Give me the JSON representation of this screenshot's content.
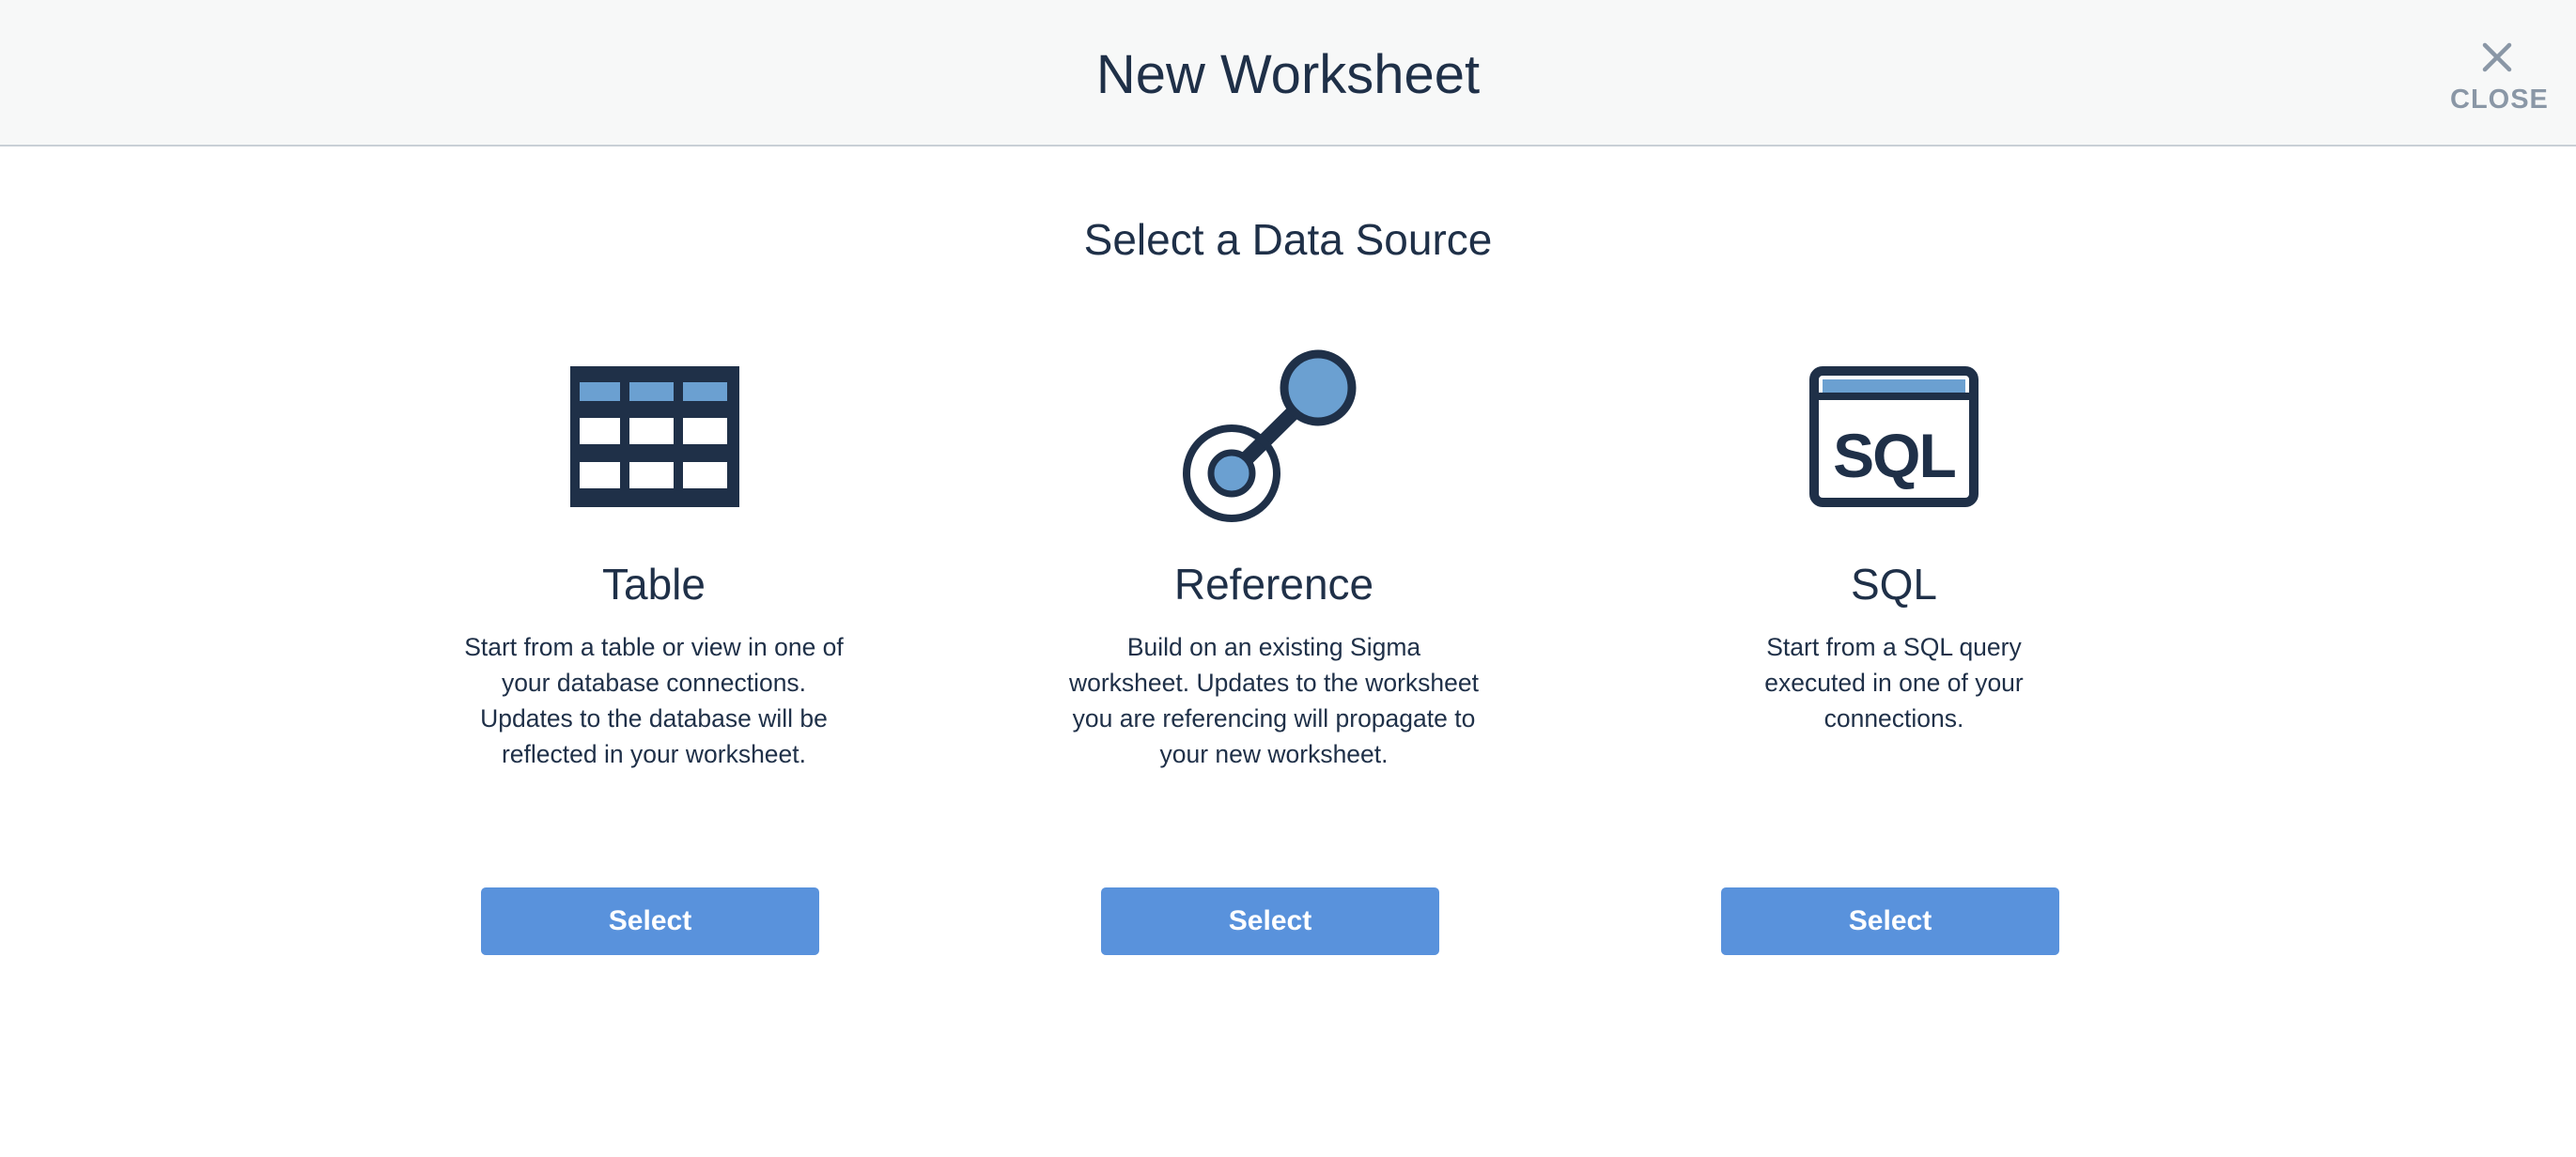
{
  "header": {
    "title": "New Worksheet",
    "close_label": "CLOSE"
  },
  "subtitle": "Select a Data Source",
  "colors": {
    "dark": "#1f3048",
    "accent_light": "#6ba0d1",
    "button": "#5992dc",
    "close_gray": "#8a97a6"
  },
  "cards": [
    {
      "icon": "table-icon",
      "title": "Table",
      "description": "Start from a table or view in one of your database connections. Updates to the database will be reflected in your worksheet.",
      "button_label": "Select"
    },
    {
      "icon": "reference-icon",
      "title": "Reference",
      "description": "Build on an existing Sigma worksheet. Updates to the worksheet you are referencing will propagate to your new worksheet.",
      "button_label": "Select"
    },
    {
      "icon": "sql-icon",
      "title": "SQL",
      "description": "Start from a SQL query executed in one of your connections.",
      "button_label": "Select",
      "icon_text": "SQL"
    }
  ]
}
